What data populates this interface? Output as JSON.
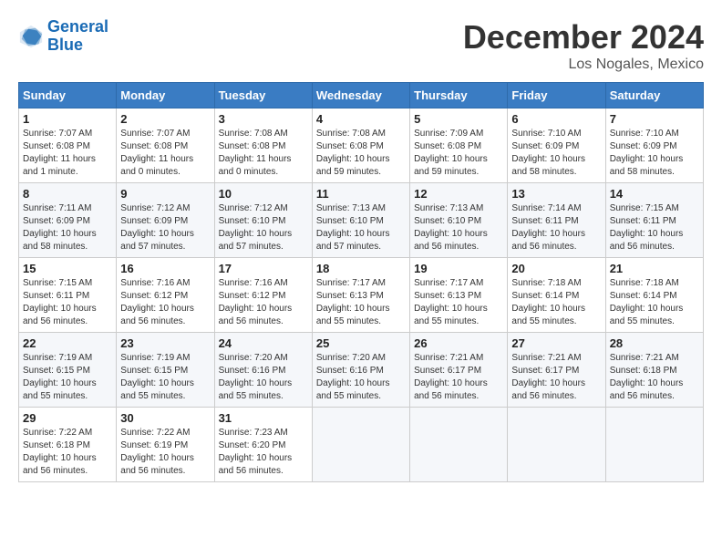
{
  "header": {
    "logo_line1": "General",
    "logo_line2": "Blue",
    "month": "December 2024",
    "location": "Los Nogales, Mexico"
  },
  "weekdays": [
    "Sunday",
    "Monday",
    "Tuesday",
    "Wednesday",
    "Thursday",
    "Friday",
    "Saturday"
  ],
  "weeks": [
    [
      {
        "day": "1",
        "info": "Sunrise: 7:07 AM\nSunset: 6:08 PM\nDaylight: 11 hours\nand 1 minute."
      },
      {
        "day": "2",
        "info": "Sunrise: 7:07 AM\nSunset: 6:08 PM\nDaylight: 11 hours\nand 0 minutes."
      },
      {
        "day": "3",
        "info": "Sunrise: 7:08 AM\nSunset: 6:08 PM\nDaylight: 11 hours\nand 0 minutes."
      },
      {
        "day": "4",
        "info": "Sunrise: 7:08 AM\nSunset: 6:08 PM\nDaylight: 10 hours\nand 59 minutes."
      },
      {
        "day": "5",
        "info": "Sunrise: 7:09 AM\nSunset: 6:08 PM\nDaylight: 10 hours\nand 59 minutes."
      },
      {
        "day": "6",
        "info": "Sunrise: 7:10 AM\nSunset: 6:09 PM\nDaylight: 10 hours\nand 58 minutes."
      },
      {
        "day": "7",
        "info": "Sunrise: 7:10 AM\nSunset: 6:09 PM\nDaylight: 10 hours\nand 58 minutes."
      }
    ],
    [
      {
        "day": "8",
        "info": "Sunrise: 7:11 AM\nSunset: 6:09 PM\nDaylight: 10 hours\nand 58 minutes."
      },
      {
        "day": "9",
        "info": "Sunrise: 7:12 AM\nSunset: 6:09 PM\nDaylight: 10 hours\nand 57 minutes."
      },
      {
        "day": "10",
        "info": "Sunrise: 7:12 AM\nSunset: 6:10 PM\nDaylight: 10 hours\nand 57 minutes."
      },
      {
        "day": "11",
        "info": "Sunrise: 7:13 AM\nSunset: 6:10 PM\nDaylight: 10 hours\nand 57 minutes."
      },
      {
        "day": "12",
        "info": "Sunrise: 7:13 AM\nSunset: 6:10 PM\nDaylight: 10 hours\nand 56 minutes."
      },
      {
        "day": "13",
        "info": "Sunrise: 7:14 AM\nSunset: 6:11 PM\nDaylight: 10 hours\nand 56 minutes."
      },
      {
        "day": "14",
        "info": "Sunrise: 7:15 AM\nSunset: 6:11 PM\nDaylight: 10 hours\nand 56 minutes."
      }
    ],
    [
      {
        "day": "15",
        "info": "Sunrise: 7:15 AM\nSunset: 6:11 PM\nDaylight: 10 hours\nand 56 minutes."
      },
      {
        "day": "16",
        "info": "Sunrise: 7:16 AM\nSunset: 6:12 PM\nDaylight: 10 hours\nand 56 minutes."
      },
      {
        "day": "17",
        "info": "Sunrise: 7:16 AM\nSunset: 6:12 PM\nDaylight: 10 hours\nand 56 minutes."
      },
      {
        "day": "18",
        "info": "Sunrise: 7:17 AM\nSunset: 6:13 PM\nDaylight: 10 hours\nand 55 minutes."
      },
      {
        "day": "19",
        "info": "Sunrise: 7:17 AM\nSunset: 6:13 PM\nDaylight: 10 hours\nand 55 minutes."
      },
      {
        "day": "20",
        "info": "Sunrise: 7:18 AM\nSunset: 6:14 PM\nDaylight: 10 hours\nand 55 minutes."
      },
      {
        "day": "21",
        "info": "Sunrise: 7:18 AM\nSunset: 6:14 PM\nDaylight: 10 hours\nand 55 minutes."
      }
    ],
    [
      {
        "day": "22",
        "info": "Sunrise: 7:19 AM\nSunset: 6:15 PM\nDaylight: 10 hours\nand 55 minutes."
      },
      {
        "day": "23",
        "info": "Sunrise: 7:19 AM\nSunset: 6:15 PM\nDaylight: 10 hours\nand 55 minutes."
      },
      {
        "day": "24",
        "info": "Sunrise: 7:20 AM\nSunset: 6:16 PM\nDaylight: 10 hours\nand 55 minutes."
      },
      {
        "day": "25",
        "info": "Sunrise: 7:20 AM\nSunset: 6:16 PM\nDaylight: 10 hours\nand 55 minutes."
      },
      {
        "day": "26",
        "info": "Sunrise: 7:21 AM\nSunset: 6:17 PM\nDaylight: 10 hours\nand 56 minutes."
      },
      {
        "day": "27",
        "info": "Sunrise: 7:21 AM\nSunset: 6:17 PM\nDaylight: 10 hours\nand 56 minutes."
      },
      {
        "day": "28",
        "info": "Sunrise: 7:21 AM\nSunset: 6:18 PM\nDaylight: 10 hours\nand 56 minutes."
      }
    ],
    [
      {
        "day": "29",
        "info": "Sunrise: 7:22 AM\nSunset: 6:18 PM\nDaylight: 10 hours\nand 56 minutes."
      },
      {
        "day": "30",
        "info": "Sunrise: 7:22 AM\nSunset: 6:19 PM\nDaylight: 10 hours\nand 56 minutes."
      },
      {
        "day": "31",
        "info": "Sunrise: 7:23 AM\nSunset: 6:20 PM\nDaylight: 10 hours\nand 56 minutes."
      },
      null,
      null,
      null,
      null
    ]
  ]
}
